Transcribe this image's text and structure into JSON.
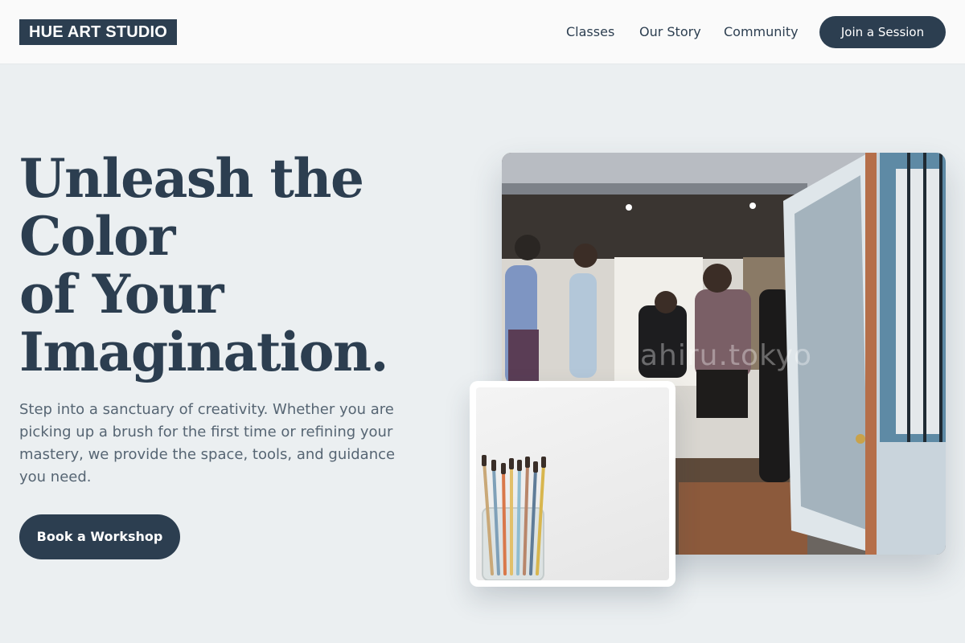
{
  "header": {
    "logo": "HUE ART STUDIO",
    "nav": [
      {
        "label": "Classes"
      },
      {
        "label": "Our Story"
      },
      {
        "label": "Community"
      }
    ],
    "join_label": "Join a Session"
  },
  "hero": {
    "title_lines": [
      "Unleash the",
      "Color",
      "of Your",
      "Imagination."
    ],
    "description": "Step into a sanctuary of creativity. Whether you are picking up a brush for the first time or refining your mastery, we provide the space, tools, and guidance you need.",
    "cta_label": "Book a Workshop"
  },
  "images": {
    "main_watermark": "ahiru.tokyo"
  },
  "colors": {
    "primary": "#2c3e50",
    "background": "#ebeff1",
    "header_bg": "#fafafa",
    "text_muted": "#566573"
  }
}
